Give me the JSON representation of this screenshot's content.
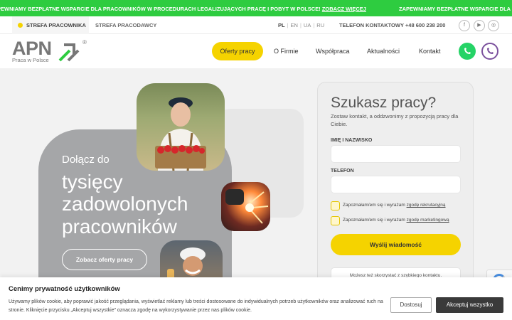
{
  "ticker": {
    "text1": "PEWNIAMY BEZPŁATNE WSPARCIE DLA PRACOWNIKÓW W PROCEDURACH LEGALIZUJĄCYCH PRACĘ I POBYT W POLSCE!",
    "link1": "ZOBACZ WIĘCEJ",
    "text2": "ZAPEWNIAMY BEZPŁATNE WSPARCIE DLA P"
  },
  "topbar": {
    "zone_worker": "STREFA PRACOWNIKA",
    "zone_employer": "STREFA PRACODAWCY",
    "languages": [
      "PL",
      "EN",
      "UA",
      "RU"
    ],
    "phone": "TELEFON KONTAKTOWY +48 600 238 200",
    "social_icons": [
      "facebook-icon",
      "youtube-icon",
      "instagram-icon"
    ]
  },
  "header": {
    "logo_text": "APN",
    "logo_reg": "®",
    "logo_sub": "Praca w Polsce",
    "nav": [
      "Oferty pracy",
      "O Firmie",
      "Współpraca",
      "Aktualności",
      "Kontakt"
    ]
  },
  "hero": {
    "join": "Dołącz do",
    "line1": "tysięcy",
    "line2": "zadowolonych",
    "line3": "pracowników",
    "cta": "Zobacz oferty pracy"
  },
  "form": {
    "title": "Szukasz pracy?",
    "subtitle": "Zostaw kontakt, a oddzwonimy z propozycją pracy dla Ciebie.",
    "name_label": "IMIĘ I NAZWISKO",
    "phone_label": "TELEFON",
    "consent1_text": "Zapoznałam/em się i wyrażam",
    "consent1_link": "zgodę rekrutacyjną",
    "consent2_text": "Zapoznałam/em się i wyrażam",
    "consent2_link": "zgodę marketingową",
    "submit": "Wyślij wiadomość",
    "quick_contact": "Możesz też skorzystać z szybkiego kontaktu."
  },
  "cookie": {
    "title": "Cenimy prywatność użytkowników",
    "text": "Używamy plików cookie, aby poprawić jakość przeglądania, wyświetlać reklamy lub treści dostosowane do indywidualnych potrzeb użytkowników oraz analizować ruch na stronie. Kliknięcie przycisku „Akceptuj wszystkie” oznacza zgodę na wykorzystywanie przez nas plików cookie.",
    "deny": "Dostosuj",
    "accept": "Akceptuj wszystko"
  },
  "colors": {
    "brand_green": "#2ecc40",
    "accent_yellow": "#f5d300",
    "hero_gray": "#a5a6a8",
    "whatsapp": "#25d366",
    "viber": "#7b519d"
  }
}
